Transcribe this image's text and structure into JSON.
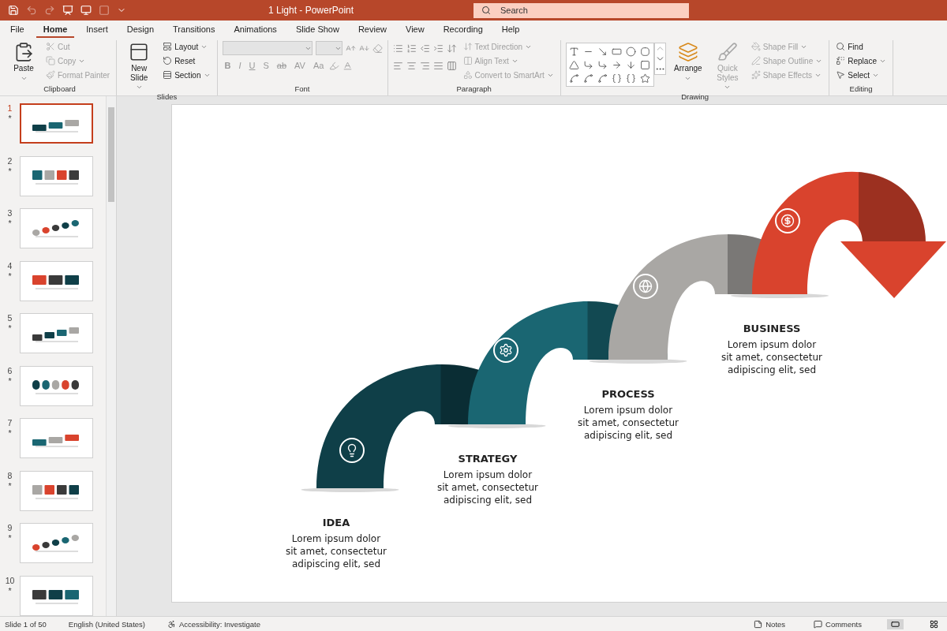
{
  "window": {
    "title": "1 Light  -  PowerPoint"
  },
  "search": {
    "placeholder": "Search"
  },
  "tabs": [
    {
      "label": "File",
      "selected": false
    },
    {
      "label": "Home",
      "selected": true
    },
    {
      "label": "Insert",
      "selected": false
    },
    {
      "label": "Design",
      "selected": false
    },
    {
      "label": "Transitions",
      "selected": false
    },
    {
      "label": "Animations",
      "selected": false
    },
    {
      "label": "Slide Show",
      "selected": false
    },
    {
      "label": "Review",
      "selected": false
    },
    {
      "label": "View",
      "selected": false
    },
    {
      "label": "Recording",
      "selected": false
    },
    {
      "label": "Help",
      "selected": false
    }
  ],
  "ribbon": [
    {
      "kind": "standard",
      "name": "Clipboard",
      "large": [
        {
          "label": "Paste",
          "disabled": false
        }
      ],
      "small": [
        {
          "label": "Cut",
          "disabled": true
        },
        {
          "label": "Copy",
          "disabled": true
        },
        {
          "label": "Format Painter",
          "disabled": true
        }
      ]
    },
    {
      "kind": "standard",
      "name": "Slides",
      "large": [
        {
          "label": "New Slide",
          "disabled": false
        }
      ],
      "small": [
        {
          "label": "Layout",
          "disabled": false
        },
        {
          "label": "Reset",
          "disabled": false
        },
        {
          "label": "Section",
          "disabled": false
        }
      ]
    },
    {
      "kind": "font",
      "name": "Font",
      "glyphs": [
        "B",
        "I",
        "U",
        "S",
        "ab",
        "AV",
        "Aa"
      ],
      "disabled": true
    },
    {
      "kind": "paragraph",
      "name": "Paragraph",
      "small": [
        {
          "label": "Text Direction",
          "disabled": true
        },
        {
          "label": "Align Text",
          "disabled": true
        },
        {
          "label": "Convert to SmartArt",
          "disabled": true
        }
      ]
    },
    {
      "kind": "drawing",
      "name": "Drawing",
      "large": [
        {
          "label": "Arrange",
          "disabled": false
        },
        {
          "label": "Quick Styles",
          "disabled": true
        }
      ],
      "small": [
        {
          "label": "Shape Fill",
          "disabled": true
        },
        {
          "label": "Shape Outline",
          "disabled": true
        },
        {
          "label": "Shape Effects",
          "disabled": true
        }
      ]
    },
    {
      "kind": "standard",
      "name": "Editing",
      "small": [
        {
          "label": "Find",
          "disabled": false
        },
        {
          "label": "Replace",
          "disabled": false
        },
        {
          "label": "Select",
          "disabled": false
        }
      ]
    }
  ],
  "thumbnails": [
    {
      "number": "1",
      "star": "*",
      "selected": true
    },
    {
      "number": "2",
      "star": "*",
      "selected": false
    },
    {
      "number": "3",
      "star": "*",
      "selected": false
    },
    {
      "number": "4",
      "star": "*",
      "selected": false
    },
    {
      "number": "5",
      "star": "*",
      "selected": false
    },
    {
      "number": "6",
      "star": "*",
      "selected": false
    },
    {
      "number": "7",
      "star": "*",
      "selected": false
    },
    {
      "number": "8",
      "star": "*",
      "selected": false
    },
    {
      "number": "9",
      "star": "*",
      "selected": false
    },
    {
      "number": "10",
      "star": "*",
      "selected": false
    }
  ],
  "slide": {
    "steps": [
      {
        "title": "IDEA",
        "text": "Lorem ipsum dolor sit amet, consectetur adipiscing elit, sed",
        "color": "#0f3f48"
      },
      {
        "title": "STRATEGY",
        "text": "Lorem ipsum dolor sit amet, consectetur adipiscing elit, sed",
        "color": "#1a6672"
      },
      {
        "title": "PROCESS",
        "text": "Lorem ipsum dolor sit amet, consectetur adipiscing elit, sed",
        "color": "#a9a7a4"
      },
      {
        "title": "BUSINESS",
        "text": "Lorem ipsum dolor sit amet, consectetur adipiscing elit, sed",
        "color": "#d9432d"
      }
    ]
  },
  "status_bar": {
    "slide": "Slide 1 of 50",
    "language": "English (United States)",
    "accessibility": "Accessibility: Investigate",
    "notes": "Notes",
    "comments": "Comments"
  }
}
